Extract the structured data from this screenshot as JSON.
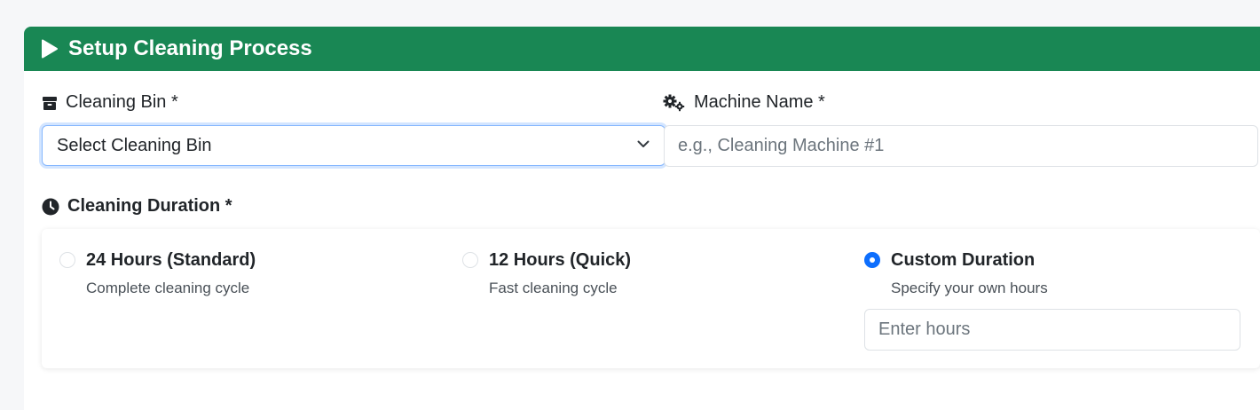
{
  "header": {
    "title": "Setup Cleaning Process",
    "icon": "play-icon"
  },
  "fields": {
    "bin": {
      "label": "Cleaning Bin *",
      "icon": "box-icon",
      "selected": "Select Cleaning Bin"
    },
    "machine": {
      "label": "Machine Name *",
      "icon": "gears-icon",
      "placeholder": "e.g., Cleaning Machine #1",
      "value": ""
    }
  },
  "duration": {
    "label": "Cleaning Duration *",
    "icon": "clock-icon",
    "options": [
      {
        "title": "24 Hours (Standard)",
        "desc": "Complete cleaning cycle",
        "checked": false
      },
      {
        "title": "12 Hours (Quick)",
        "desc": "Fast cleaning cycle",
        "checked": false
      },
      {
        "title": "Custom Duration",
        "desc": "Specify your own hours",
        "checked": true
      }
    ],
    "custom_input": {
      "placeholder": "Enter hours",
      "value": ""
    }
  },
  "colors": {
    "header_bg": "#198754",
    "accent": "#0d6efd",
    "focus_border": "#86b7fe"
  }
}
